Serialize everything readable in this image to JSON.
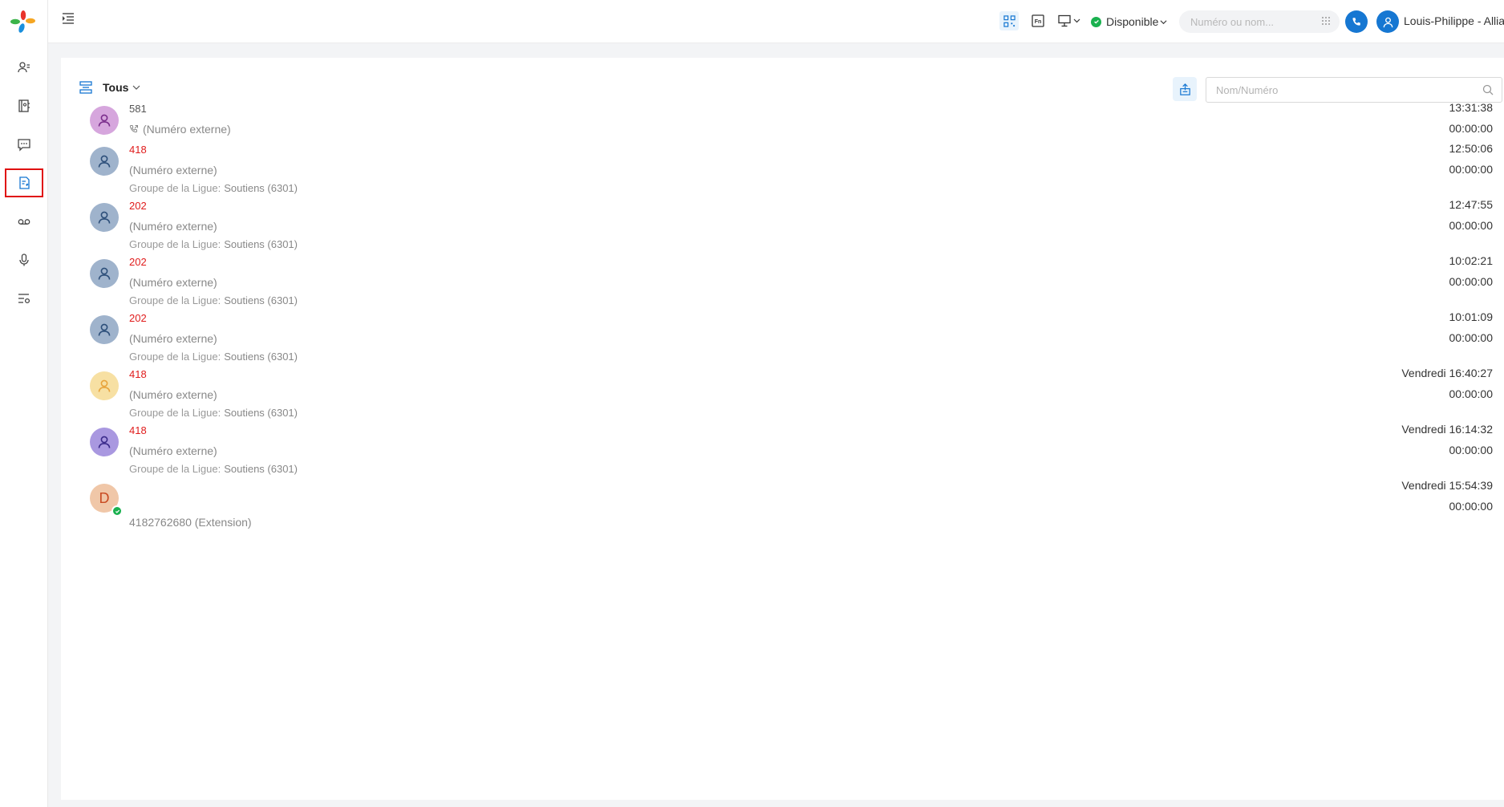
{
  "sidebar": {
    "items": [
      {
        "name": "contacts",
        "icon": "contacts-icon"
      },
      {
        "name": "phonebook",
        "icon": "phonebook-icon"
      },
      {
        "name": "messages",
        "icon": "chat-icon"
      },
      {
        "name": "call-logs",
        "icon": "call-log-icon",
        "active": true
      },
      {
        "name": "voicemail",
        "icon": "voicemail-icon"
      },
      {
        "name": "recordings",
        "icon": "microphone-icon"
      },
      {
        "name": "settings",
        "icon": "list-settings-icon"
      }
    ]
  },
  "header": {
    "status_label": "Disponible",
    "dial_placeholder": "Numéro ou nom...",
    "user_name": "Louis-Philippe - Allianc"
  },
  "toolbar": {
    "filter_label": "Tous",
    "search_placeholder": "Nom/Numéro"
  },
  "calls": [
    {
      "number": "581",
      "number_color": "gray",
      "line2": "(Numéro externe)",
      "show_call_icon": true,
      "group_label": "",
      "group_value": "",
      "time": "13:31:38",
      "duration": "00:00:00",
      "avatar": "purple"
    },
    {
      "number": "418",
      "number_color": "red",
      "line2": "(Numéro externe)",
      "show_call_icon": false,
      "group_label": "Groupe de la Ligue:",
      "group_value": "Soutiens (6301)",
      "time": "12:50:06",
      "duration": "00:00:00",
      "avatar": "slate"
    },
    {
      "number": "202",
      "number_color": "red",
      "line2": "(Numéro externe)",
      "show_call_icon": false,
      "group_label": "Groupe de la Ligue:",
      "group_value": "Soutiens (6301)",
      "time": "12:47:55",
      "duration": "00:00:00",
      "avatar": "slate"
    },
    {
      "number": "202",
      "number_color": "red",
      "line2": "(Numéro externe)",
      "show_call_icon": false,
      "group_label": "Groupe de la Ligue:",
      "group_value": "Soutiens (6301)",
      "time": "10:02:21",
      "duration": "00:00:00",
      "avatar": "slate"
    },
    {
      "number": "202",
      "number_color": "red",
      "line2": "(Numéro externe)",
      "show_call_icon": false,
      "group_label": "Groupe de la Ligue:",
      "group_value": "Soutiens (6301)",
      "time": "10:01:09",
      "duration": "00:00:00",
      "avatar": "slate"
    },
    {
      "number": "418",
      "number_color": "red",
      "line2": "(Numéro externe)",
      "show_call_icon": false,
      "group_label": "Groupe de la Ligue:",
      "group_value": "Soutiens (6301)",
      "time": "Vendredi 16:40:27",
      "duration": "00:00:00",
      "avatar": "yellow"
    },
    {
      "number": "418",
      "number_color": "red",
      "line2": "(Numéro externe)",
      "show_call_icon": false,
      "group_label": "Groupe de la Ligue:",
      "group_value": "Soutiens (6301)",
      "time": "Vendredi 16:14:32",
      "duration": "00:00:00",
      "avatar": "violet"
    },
    {
      "number": "",
      "number_color": "gray",
      "line2": "4182762680 (Extension)",
      "show_call_icon": false,
      "group_label": "",
      "group_value": "",
      "time": "Vendredi 15:54:39",
      "duration": "00:00:00",
      "avatar": "letter",
      "avatar_letter": "D",
      "online": true
    }
  ],
  "colors": {
    "accent": "#1677d2",
    "missed": "#e01c1c",
    "online": "#1ab14f"
  }
}
